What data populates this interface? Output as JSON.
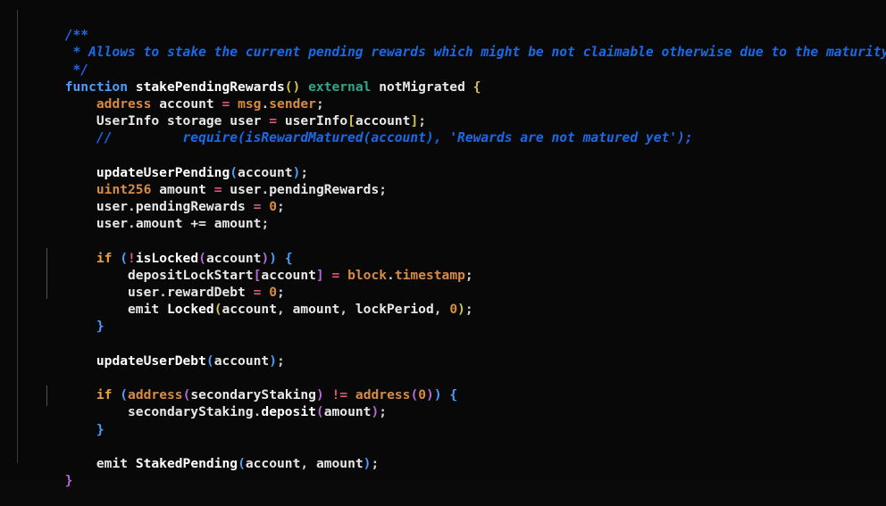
{
  "editor": {
    "language": "solidity",
    "background_color": "#080808",
    "font_size_px": 14.6,
    "line_height_px": 19.2,
    "indent_guide_color": "#3a3a42",
    "theme_colors": {
      "comment": "#1a6ae8",
      "keyword": "#4a9eff",
      "control": "#e8a33d",
      "type": "#d98b3f",
      "identifier": "#e8e8e8",
      "modifier": "#2fa88a",
      "number": "#d98b3f",
      "operator": "#e0567a",
      "bracket_gold": "#d6c44a",
      "bracket_blue": "#4a9eff",
      "bracket_purple": "#b668d6"
    }
  },
  "code": {
    "lines": [
      {
        "id": "l1",
        "text": "/**"
      },
      {
        "id": "l2",
        "text": " * Allows to stake the current pending rewards which might be not claimable otherwise due to the maturity period."
      },
      {
        "id": "l3",
        "text": " */"
      },
      {
        "id": "l4",
        "text": "function stakePendingRewards() external notMigrated {"
      },
      {
        "id": "l5",
        "text": "    address account = msg.sender;"
      },
      {
        "id": "l6",
        "text": "    UserInfo storage user = userInfo[account];"
      },
      {
        "id": "l7",
        "text": "    //         require(isRewardMatured(account), 'Rewards are not matured yet');"
      },
      {
        "id": "l8",
        "text": ""
      },
      {
        "id": "l9",
        "text": "    updateUserPending(account);"
      },
      {
        "id": "l10",
        "text": "    uint256 amount = user.pendingRewards;"
      },
      {
        "id": "l11",
        "text": "    user.pendingRewards = 0;"
      },
      {
        "id": "l12",
        "text": "    user.amount += amount;"
      },
      {
        "id": "l13",
        "text": ""
      },
      {
        "id": "l14",
        "text": "    if (!isLocked(account)) {"
      },
      {
        "id": "l15",
        "text": "        depositLockStart[account] = block.timestamp;"
      },
      {
        "id": "l16",
        "text": "        user.rewardDebt = 0;"
      },
      {
        "id": "l17",
        "text": "        emit Locked(account, amount, lockPeriod, 0);"
      },
      {
        "id": "l18",
        "text": "    }"
      },
      {
        "id": "l19",
        "text": ""
      },
      {
        "id": "l20",
        "text": "    updateUserDebt(account);"
      },
      {
        "id": "l21",
        "text": ""
      },
      {
        "id": "l22",
        "text": "    if (address(secondaryStaking) != address(0)) {"
      },
      {
        "id": "l23",
        "text": "        secondaryStaking.deposit(amount);"
      },
      {
        "id": "l24",
        "text": "    }"
      },
      {
        "id": "l25",
        "text": ""
      },
      {
        "id": "l26",
        "text": "    emit StakedPending(account, amount);"
      },
      {
        "id": "l27",
        "text": "}"
      }
    ],
    "doc_comment": {
      "open": "/**",
      "body": " * Allows to stake the current pending rewards which might be not claimable otherwise due to the maturity period.",
      "close": " */"
    },
    "signature": {
      "keyword": "function",
      "name": "stakePendingRewards",
      "params": "()",
      "visibility": "external",
      "modifier": "notMigrated",
      "open_brace": "{"
    },
    "tokens": {
      "t_l5_type": "address",
      "t_l5_name": "account",
      "t_l5_eq": "=",
      "t_l5_glob": "msg",
      "t_l5_dot": ".",
      "t_l5_prop": "sender",
      "t_l5_semi": ";",
      "t_l6_type": "UserInfo",
      "t_l6_storage": "storage",
      "t_l6_name": "user",
      "t_l6_eq": "=",
      "t_l6_map": "userInfo",
      "t_l6_lb": "[",
      "t_l6_key": "account",
      "t_l6_rb": "]",
      "t_l6_semi": ";",
      "t_l7_comment": "//         require(isRewardMatured(account), 'Rewards are not matured yet');",
      "t_l9_fn": "updateUserPending",
      "t_l9_lp": "(",
      "t_l9_arg": "account",
      "t_l9_rp": ")",
      "t_l9_semi": ";",
      "t_l10_type": "uint256",
      "t_l10_name": "amount",
      "t_l10_eq": "=",
      "t_l10_obj": "user",
      "t_l10_dot": ".",
      "t_l10_prop": "pendingRewards",
      "t_l10_semi": ";",
      "t_l11_obj": "user",
      "t_l11_dot": ".",
      "t_l11_prop": "pendingRewards",
      "t_l11_eq": "=",
      "t_l11_num": "0",
      "t_l11_semi": ";",
      "t_l12_obj": "user",
      "t_l12_dot": ".",
      "t_l12_prop": "amount",
      "t_l12_op": "+=",
      "t_l12_val": "amount",
      "t_l12_semi": ";",
      "t_l14_if": "if",
      "t_l14_lp": "(",
      "t_l14_bang": "!",
      "t_l14_fn": "isLocked",
      "t_l14_lp2": "(",
      "t_l14_arg": "account",
      "t_l14_rp2": ")",
      "t_l14_rp": ")",
      "t_l14_brace": "{",
      "t_l15_map": "depositLockStart",
      "t_l15_lb": "[",
      "t_l15_key": "account",
      "t_l15_rb": "]",
      "t_l15_eq": "=",
      "t_l15_glob": "block",
      "t_l15_dot": ".",
      "t_l15_prop": "timestamp",
      "t_l15_semi": ";",
      "t_l16_obj": "user",
      "t_l16_dot": ".",
      "t_l16_prop": "rewardDebt",
      "t_l16_eq": "=",
      "t_l16_num": "0",
      "t_l16_semi": ";",
      "t_l17_emit": "emit",
      "t_l17_evt": "Locked",
      "t_l17_lp": "(",
      "t_l17_a1": "account",
      "t_l17_c1": ", ",
      "t_l17_a2": "amount",
      "t_l17_c2": ", ",
      "t_l17_a3": "lockPeriod",
      "t_l17_c3": ", ",
      "t_l17_a4": "0",
      "t_l17_rp": ")",
      "t_l17_semi": ";",
      "t_l18_brace": "}",
      "t_l20_fn": "updateUserDebt",
      "t_l20_lp": "(",
      "t_l20_arg": "account",
      "t_l20_rp": ")",
      "t_l20_semi": ";",
      "t_l22_if": "if",
      "t_l22_lp": "(",
      "t_l22_cast": "address",
      "t_l22_lp2": "(",
      "t_l22_arg": "secondaryStaking",
      "t_l22_rp2": ")",
      "t_l22_neq": "!=",
      "t_l22_cast2": "address",
      "t_l22_lp3": "(",
      "t_l22_num": "0",
      "t_l22_rp3": ")",
      "t_l22_rp": ")",
      "t_l22_brace": "{",
      "t_l23_obj": "secondaryStaking",
      "t_l23_dot": ".",
      "t_l23_fn": "deposit",
      "t_l23_lp": "(",
      "t_l23_arg": "amount",
      "t_l23_rp": ")",
      "t_l23_semi": ";",
      "t_l24_brace": "}",
      "t_l26_emit": "emit",
      "t_l26_evt": "StakedPending",
      "t_l26_lp": "(",
      "t_l26_a1": "account",
      "t_l26_c1": ", ",
      "t_l26_a2": "amount",
      "t_l26_rp": ")",
      "t_l26_semi": ";",
      "t_l27_brace": "}"
    },
    "indent": {
      "i4": "    ",
      "i8": "        "
    }
  }
}
